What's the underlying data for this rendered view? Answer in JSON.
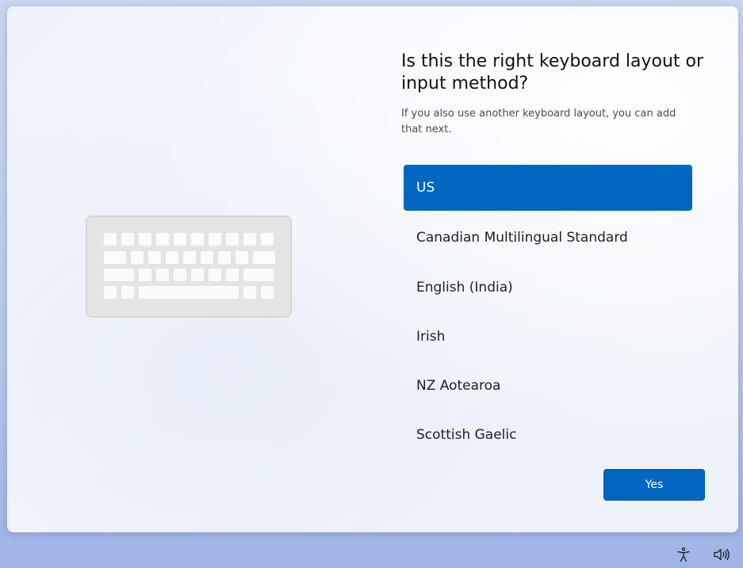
{
  "page": {
    "title": "Is this the right keyboard layout or input method?",
    "subtitle": "If you also use another keyboard layout, you can add that next."
  },
  "layouts": {
    "selected_index": 0,
    "items": [
      {
        "label": "US"
      },
      {
        "label": "Canadian Multilingual Standard"
      },
      {
        "label": "English (India)"
      },
      {
        "label": "Irish"
      },
      {
        "label": "NZ Aotearoa"
      },
      {
        "label": "Scottish Gaelic"
      }
    ]
  },
  "actions": {
    "yes_label": "Yes"
  },
  "taskbar": {
    "icons": [
      "accessibility-icon",
      "volume-icon"
    ]
  },
  "colors": {
    "accent": "#0067c0",
    "selected_text": "#ffffff"
  }
}
